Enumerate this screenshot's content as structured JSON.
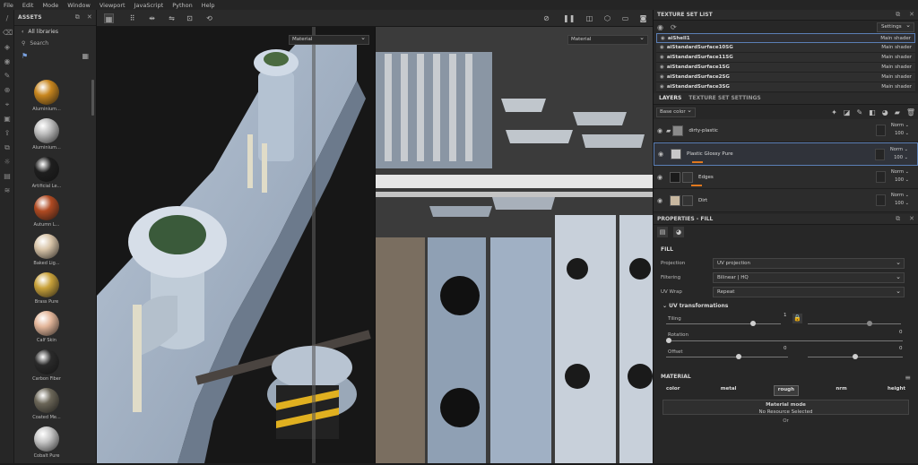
{
  "menu": [
    "File",
    "Edit",
    "Mode",
    "Window",
    "Viewport",
    "JavaScript",
    "Python",
    "Help"
  ],
  "assets": {
    "title": "ASSETS",
    "library": "All libraries",
    "search_placeholder": "Search",
    "items": [
      {
        "label": "Aluminium...",
        "color": "#c8861e"
      },
      {
        "label": "Aluminium...",
        "color": "#bdbdbd"
      },
      {
        "label": "Artificial Le...",
        "color": "#1e1e1e"
      },
      {
        "label": "Autumn L...",
        "color": "#b04a22"
      },
      {
        "label": "Baked Lig...",
        "color": "#d8c4a8"
      },
      {
        "label": "Brass Pure",
        "color": "#c9a23a"
      },
      {
        "label": "Calf Skin",
        "color": "#e3b69a"
      },
      {
        "label": "Carbon Fiber",
        "color": "#2a2a2a"
      },
      {
        "label": "Coated Me...",
        "color": "#6b6658"
      },
      {
        "label": "Cobalt Pure",
        "color": "#c6c6c6"
      }
    ]
  },
  "viewport": {
    "left_mode": "Material",
    "right_mode": "Material"
  },
  "texture_set_list": {
    "title": "TEXTURE SET LIST",
    "settings_label": "Settings",
    "rows": [
      {
        "name": "aiShell1",
        "shader": "Main shader"
      },
      {
        "name": "aiStandardSurface10SG",
        "shader": "Main shader"
      },
      {
        "name": "aiStandardSurface11SG",
        "shader": "Main shader"
      },
      {
        "name": "aiStandardSurface1SG",
        "shader": "Main shader"
      },
      {
        "name": "aiStandardSurface2SG",
        "shader": "Main shader"
      },
      {
        "name": "aiStandardSurface3SG",
        "shader": "Main shader"
      }
    ]
  },
  "layers": {
    "tab_layers": "LAYERS",
    "tab_settings": "TEXTURE SET SETTINGS",
    "channel": "Base color",
    "items": [
      {
        "name": "dirty-plastic",
        "blend": "Norm",
        "opacity": "100"
      },
      {
        "name": "Plastic Glossy Pure",
        "blend": "Norm",
        "opacity": "100"
      },
      {
        "name": "Edges",
        "blend": "Norm",
        "opacity": "100"
      },
      {
        "name": "Dirt",
        "blend": "Norm",
        "opacity": "100"
      }
    ]
  },
  "properties": {
    "title": "PROPERTIES - FILL",
    "fill_label": "FILL",
    "projection_label": "Projection",
    "projection_value": "UV projection",
    "filtering_label": "Filtering",
    "filtering_value": "Bilinear | HQ",
    "uvwrap_label": "UV Wrap",
    "uvwrap_value": "Repeat",
    "uv_transform_label": "UV transformations",
    "tiling_label": "Tiling",
    "tiling_value": "1",
    "rotation_label": "Rotation",
    "rotation_value": "0",
    "offset_label": "Offset",
    "offset_value_a": "0",
    "offset_value_b": "0",
    "material_label": "MATERIAL",
    "channels": [
      "color",
      "metal",
      "rough",
      "nrm",
      "height"
    ],
    "material_mode_label": "Material mode",
    "material_mode_value": "No Resource Selected",
    "bottom_text": "Or"
  }
}
